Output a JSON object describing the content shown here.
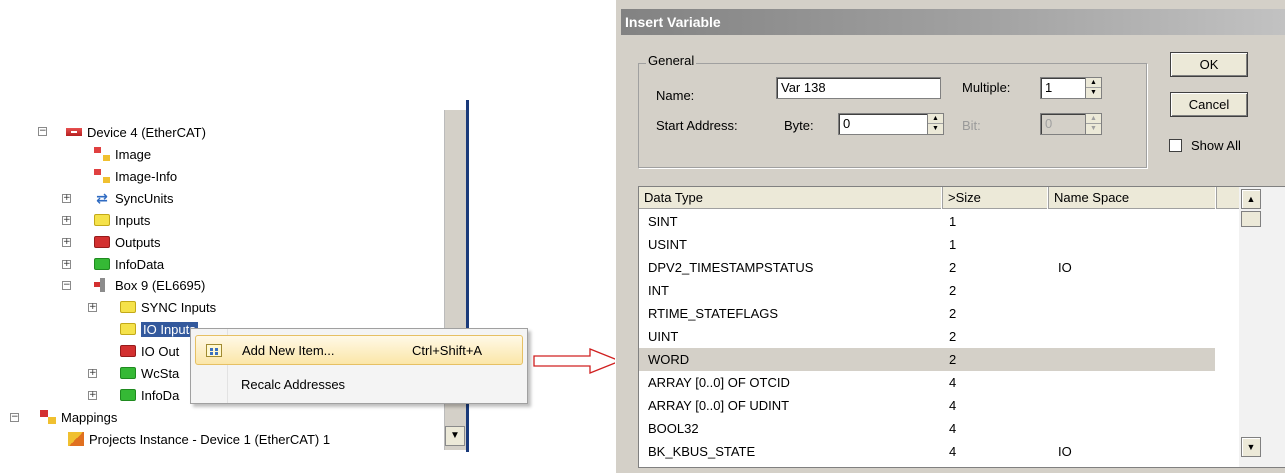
{
  "tree": {
    "device4": "Device 4 (EtherCAT)",
    "image": "Image",
    "image_info": "Image-Info",
    "syncunits": "SyncUnits",
    "inputs": "Inputs",
    "outputs": "Outputs",
    "infodata": "InfoData",
    "box9": "Box 9 (EL6695)",
    "sync_inputs": "SYNC Inputs",
    "io_inputs": "IO Inputs",
    "io_outputs": "IO Out",
    "wcstate": "WcSta",
    "infodata2": "InfoDa",
    "mappings": "Mappings",
    "projects_instance": "Projects Instance - Device 1 (EtherCAT) 1",
    "expand": "+",
    "collapse": "−"
  },
  "context_menu": {
    "add_new_item": "Add New Item...",
    "add_shortcut": "Ctrl+Shift+A",
    "recalc": "Recalc Addresses"
  },
  "dialog": {
    "title": "Insert Variable",
    "ok": "OK",
    "cancel": "Cancel",
    "show_all": "Show All",
    "general": "General",
    "name_label": "Name:",
    "name_value": "Var 138",
    "multiple_label": "Multiple:",
    "multiple_value": "1",
    "start_address_label": "Start Address:",
    "byte_label": "Byte:",
    "byte_value": "0",
    "bit_label": "Bit:",
    "bit_value": "0",
    "columns": [
      "Data Type",
      ">Size",
      "Name Space"
    ],
    "rows": [
      {
        "type": "SINT",
        "size": "1",
        "ns": ""
      },
      {
        "type": "USINT",
        "size": "1",
        "ns": ""
      },
      {
        "type": "DPV2_TIMESTAMPSTATUS",
        "size": "2",
        "ns": "IO"
      },
      {
        "type": "INT",
        "size": "2",
        "ns": ""
      },
      {
        "type": "RTIME_STATEFLAGS",
        "size": "2",
        "ns": ""
      },
      {
        "type": "UINT",
        "size": "2",
        "ns": ""
      },
      {
        "type": "WORD",
        "size": "2",
        "ns": ""
      },
      {
        "type": "ARRAY [0..0] OF OTCID",
        "size": "4",
        "ns": ""
      },
      {
        "type": "ARRAY [0..0] OF UDINT",
        "size": "4",
        "ns": ""
      },
      {
        "type": "BOOL32",
        "size": "4",
        "ns": ""
      },
      {
        "type": "BK_KBUS_STATE",
        "size": "4",
        "ns": "IO"
      }
    ],
    "selected_row": 6
  }
}
